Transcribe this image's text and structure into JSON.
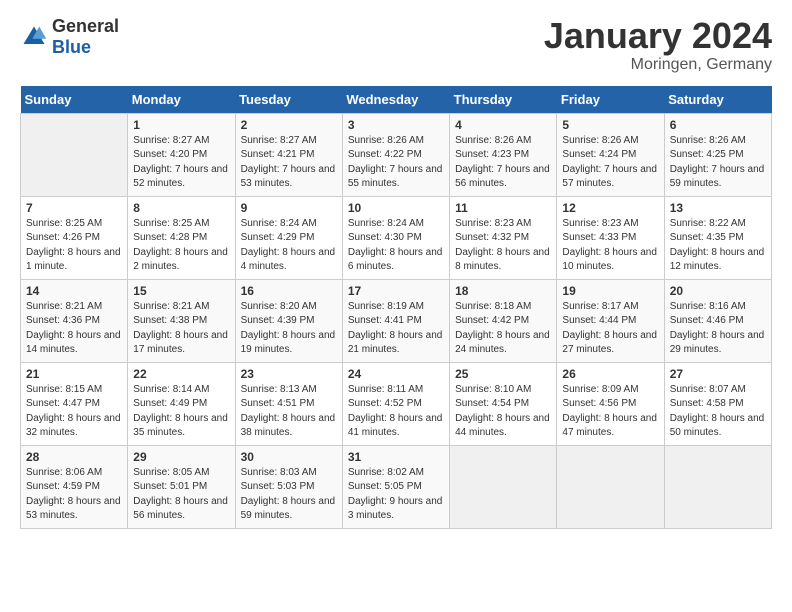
{
  "logo": {
    "general": "General",
    "blue": "Blue"
  },
  "title": "January 2024",
  "location": "Moringen, Germany",
  "days_header": [
    "Sunday",
    "Monday",
    "Tuesday",
    "Wednesday",
    "Thursday",
    "Friday",
    "Saturday"
  ],
  "weeks": [
    [
      {
        "num": "",
        "sunrise": "",
        "sunset": "",
        "daylight": "",
        "empty": true
      },
      {
        "num": "1",
        "sunrise": "Sunrise: 8:27 AM",
        "sunset": "Sunset: 4:20 PM",
        "daylight": "Daylight: 7 hours and 52 minutes."
      },
      {
        "num": "2",
        "sunrise": "Sunrise: 8:27 AM",
        "sunset": "Sunset: 4:21 PM",
        "daylight": "Daylight: 7 hours and 53 minutes."
      },
      {
        "num": "3",
        "sunrise": "Sunrise: 8:26 AM",
        "sunset": "Sunset: 4:22 PM",
        "daylight": "Daylight: 7 hours and 55 minutes."
      },
      {
        "num": "4",
        "sunrise": "Sunrise: 8:26 AM",
        "sunset": "Sunset: 4:23 PM",
        "daylight": "Daylight: 7 hours and 56 minutes."
      },
      {
        "num": "5",
        "sunrise": "Sunrise: 8:26 AM",
        "sunset": "Sunset: 4:24 PM",
        "daylight": "Daylight: 7 hours and 57 minutes."
      },
      {
        "num": "6",
        "sunrise": "Sunrise: 8:26 AM",
        "sunset": "Sunset: 4:25 PM",
        "daylight": "Daylight: 7 hours and 59 minutes."
      }
    ],
    [
      {
        "num": "7",
        "sunrise": "Sunrise: 8:25 AM",
        "sunset": "Sunset: 4:26 PM",
        "daylight": "Daylight: 8 hours and 1 minute."
      },
      {
        "num": "8",
        "sunrise": "Sunrise: 8:25 AM",
        "sunset": "Sunset: 4:28 PM",
        "daylight": "Daylight: 8 hours and 2 minutes."
      },
      {
        "num": "9",
        "sunrise": "Sunrise: 8:24 AM",
        "sunset": "Sunset: 4:29 PM",
        "daylight": "Daylight: 8 hours and 4 minutes."
      },
      {
        "num": "10",
        "sunrise": "Sunrise: 8:24 AM",
        "sunset": "Sunset: 4:30 PM",
        "daylight": "Daylight: 8 hours and 6 minutes."
      },
      {
        "num": "11",
        "sunrise": "Sunrise: 8:23 AM",
        "sunset": "Sunset: 4:32 PM",
        "daylight": "Daylight: 8 hours and 8 minutes."
      },
      {
        "num": "12",
        "sunrise": "Sunrise: 8:23 AM",
        "sunset": "Sunset: 4:33 PM",
        "daylight": "Daylight: 8 hours and 10 minutes."
      },
      {
        "num": "13",
        "sunrise": "Sunrise: 8:22 AM",
        "sunset": "Sunset: 4:35 PM",
        "daylight": "Daylight: 8 hours and 12 minutes."
      }
    ],
    [
      {
        "num": "14",
        "sunrise": "Sunrise: 8:21 AM",
        "sunset": "Sunset: 4:36 PM",
        "daylight": "Daylight: 8 hours and 14 minutes."
      },
      {
        "num": "15",
        "sunrise": "Sunrise: 8:21 AM",
        "sunset": "Sunset: 4:38 PM",
        "daylight": "Daylight: 8 hours and 17 minutes."
      },
      {
        "num": "16",
        "sunrise": "Sunrise: 8:20 AM",
        "sunset": "Sunset: 4:39 PM",
        "daylight": "Daylight: 8 hours and 19 minutes."
      },
      {
        "num": "17",
        "sunrise": "Sunrise: 8:19 AM",
        "sunset": "Sunset: 4:41 PM",
        "daylight": "Daylight: 8 hours and 21 minutes."
      },
      {
        "num": "18",
        "sunrise": "Sunrise: 8:18 AM",
        "sunset": "Sunset: 4:42 PM",
        "daylight": "Daylight: 8 hours and 24 minutes."
      },
      {
        "num": "19",
        "sunrise": "Sunrise: 8:17 AM",
        "sunset": "Sunset: 4:44 PM",
        "daylight": "Daylight: 8 hours and 27 minutes."
      },
      {
        "num": "20",
        "sunrise": "Sunrise: 8:16 AM",
        "sunset": "Sunset: 4:46 PM",
        "daylight": "Daylight: 8 hours and 29 minutes."
      }
    ],
    [
      {
        "num": "21",
        "sunrise": "Sunrise: 8:15 AM",
        "sunset": "Sunset: 4:47 PM",
        "daylight": "Daylight: 8 hours and 32 minutes."
      },
      {
        "num": "22",
        "sunrise": "Sunrise: 8:14 AM",
        "sunset": "Sunset: 4:49 PM",
        "daylight": "Daylight: 8 hours and 35 minutes."
      },
      {
        "num": "23",
        "sunrise": "Sunrise: 8:13 AM",
        "sunset": "Sunset: 4:51 PM",
        "daylight": "Daylight: 8 hours and 38 minutes."
      },
      {
        "num": "24",
        "sunrise": "Sunrise: 8:11 AM",
        "sunset": "Sunset: 4:52 PM",
        "daylight": "Daylight: 8 hours and 41 minutes."
      },
      {
        "num": "25",
        "sunrise": "Sunrise: 8:10 AM",
        "sunset": "Sunset: 4:54 PM",
        "daylight": "Daylight: 8 hours and 44 minutes."
      },
      {
        "num": "26",
        "sunrise": "Sunrise: 8:09 AM",
        "sunset": "Sunset: 4:56 PM",
        "daylight": "Daylight: 8 hours and 47 minutes."
      },
      {
        "num": "27",
        "sunrise": "Sunrise: 8:07 AM",
        "sunset": "Sunset: 4:58 PM",
        "daylight": "Daylight: 8 hours and 50 minutes."
      }
    ],
    [
      {
        "num": "28",
        "sunrise": "Sunrise: 8:06 AM",
        "sunset": "Sunset: 4:59 PM",
        "daylight": "Daylight: 8 hours and 53 minutes."
      },
      {
        "num": "29",
        "sunrise": "Sunrise: 8:05 AM",
        "sunset": "Sunset: 5:01 PM",
        "daylight": "Daylight: 8 hours and 56 minutes."
      },
      {
        "num": "30",
        "sunrise": "Sunrise: 8:03 AM",
        "sunset": "Sunset: 5:03 PM",
        "daylight": "Daylight: 8 hours and 59 minutes."
      },
      {
        "num": "31",
        "sunrise": "Sunrise: 8:02 AM",
        "sunset": "Sunset: 5:05 PM",
        "daylight": "Daylight: 9 hours and 3 minutes."
      },
      {
        "num": "",
        "sunrise": "",
        "sunset": "",
        "daylight": "",
        "empty": true
      },
      {
        "num": "",
        "sunrise": "",
        "sunset": "",
        "daylight": "",
        "empty": true
      },
      {
        "num": "",
        "sunrise": "",
        "sunset": "",
        "daylight": "",
        "empty": true
      }
    ]
  ]
}
